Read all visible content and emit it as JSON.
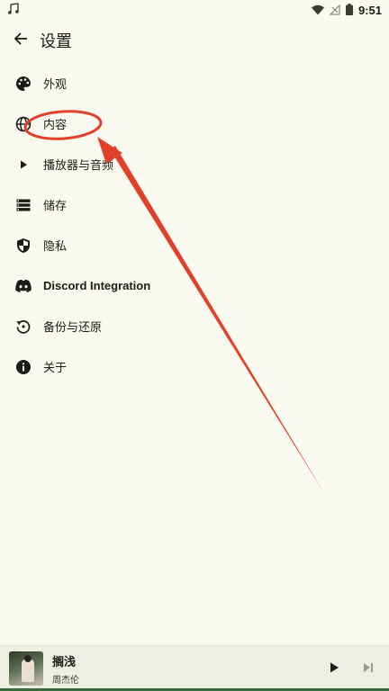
{
  "status_bar": {
    "time": "9:51",
    "music_icon": "music-note-icon",
    "wifi_icon": "wifi-icon",
    "signal_icon": "no-signal-icon",
    "battery_icon": "battery-icon"
  },
  "header": {
    "title": "设置",
    "back_icon": "arrow-back-icon"
  },
  "settings": {
    "items": [
      {
        "label": "外观",
        "icon": "palette-icon"
      },
      {
        "label": "内容",
        "icon": "globe-icon"
      },
      {
        "label": "播放器与音频",
        "icon": "play-icon"
      },
      {
        "label": "储存",
        "icon": "storage-icon"
      },
      {
        "label": "隐私",
        "icon": "shield-icon"
      },
      {
        "label": "Discord Integration",
        "icon": "discord-icon"
      },
      {
        "label": "备份与还原",
        "icon": "restore-icon"
      },
      {
        "label": "关于",
        "icon": "info-icon"
      }
    ]
  },
  "player": {
    "title": "搁浅",
    "artist": "周杰伦",
    "play_icon": "play-icon",
    "next_icon": "skip-next-icon"
  },
  "colors": {
    "background": "#fbfaf0",
    "annotation": "#e0412a",
    "accent": "#3b6b3b"
  }
}
